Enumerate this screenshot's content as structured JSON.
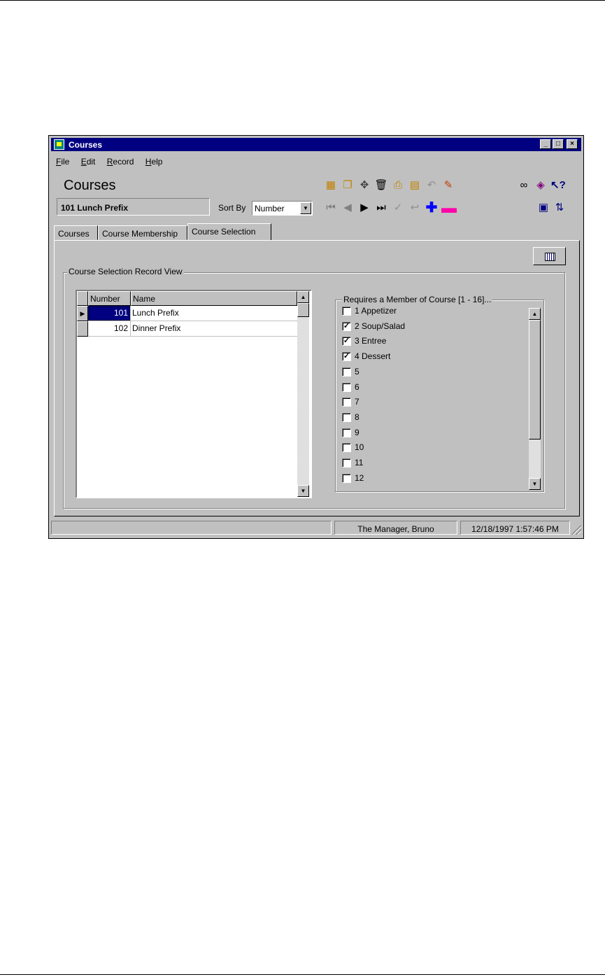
{
  "window": {
    "title": "Courses",
    "controls": {
      "minimize": "_",
      "maximize": "□",
      "close": "×"
    }
  },
  "menu": [
    {
      "key": "F",
      "rest": "ile"
    },
    {
      "key": "E",
      "rest": "dit"
    },
    {
      "key": "R",
      "rest": "ecord"
    },
    {
      "key": "H",
      "rest": "elp"
    }
  ],
  "header": {
    "title": "Courses",
    "current_record": "101 Lunch Prefix",
    "sort_by_label": "Sort By",
    "sort_by_value": "Number"
  },
  "toolbar": {
    "icons": [
      "report-icon",
      "copy-record-icon",
      "paste-record-icon",
      "delete-trash-icon",
      "print-icon",
      "export-icon",
      "undo-icon",
      "clear-icon",
      "find-binoculars-icon",
      "bookbook-icon",
      "whats-this-help-icon"
    ],
    "nav": [
      "first-record-icon",
      "previous-record-icon",
      "next-record-icon",
      "last-record-icon",
      "save-check-icon",
      "cancel-undo-icon",
      "add-record-icon",
      "remove-record-icon",
      "display-icon",
      "transfer-icon"
    ],
    "colors": {
      "add": "#0000ff",
      "remove": "#ff00aa",
      "yellow": "#e0c000"
    }
  },
  "tabs": [
    {
      "label": "Courses",
      "active": false
    },
    {
      "label": "Course Membership",
      "active": false
    },
    {
      "label": "Course Selection",
      "active": true
    }
  ],
  "record_view": {
    "group_title": "Course Selection Record View",
    "grid": {
      "columns": [
        "Number",
        "Name"
      ],
      "rows": [
        {
          "number": "101",
          "name": "Lunch Prefix",
          "selected": true
        },
        {
          "number": "102",
          "name": "Dinner Prefix",
          "selected": false
        }
      ]
    },
    "requires": {
      "group_title": "Requires a Member of Course [1 - 16]...",
      "items": [
        {
          "label": "1  Appetizer",
          "checked": false
        },
        {
          "label": "2  Soup/Salad",
          "checked": true
        },
        {
          "label": "3  Entree",
          "checked": true
        },
        {
          "label": "4  Dessert",
          "checked": true
        },
        {
          "label": "5",
          "checked": false
        },
        {
          "label": "6",
          "checked": false
        },
        {
          "label": "7",
          "checked": false
        },
        {
          "label": "8",
          "checked": false
        },
        {
          "label": "9",
          "checked": false
        },
        {
          "label": "10",
          "checked": false
        },
        {
          "label": "11",
          "checked": false
        },
        {
          "label": "12",
          "checked": false
        }
      ]
    }
  },
  "status": {
    "user": "The Manager, Bruno",
    "datetime": "12/18/1997 1:57:46 PM"
  }
}
